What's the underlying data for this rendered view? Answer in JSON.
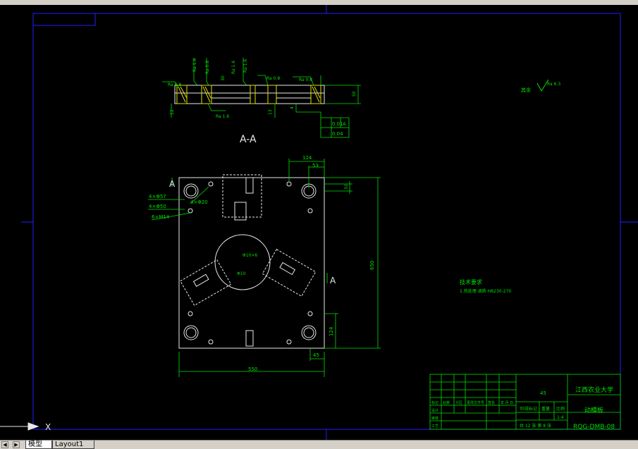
{
  "toolbar": {
    "icons": [
      "new-icon",
      "open-icon",
      "save-icon",
      "print-icon",
      "undo-icon",
      "redo-icon",
      "pan-icon",
      "zoom-icon",
      "properties-icon",
      "layer-icon",
      "color-icon",
      "linetype-icon"
    ]
  },
  "drawing": {
    "section_label": "A-A",
    "view_label_left": "A",
    "view_label_right": "A",
    "title_block": {
      "school": "江西农业大学",
      "part_name": "动模板",
      "drawing_number": "RQG-DMB-08",
      "material": "45",
      "scale": "1:4",
      "sheets": "共 12 张  第 8 张",
      "row_labels": [
        "标记",
        "处数",
        "分区",
        "更改文件号",
        "签名",
        "年 月 日"
      ],
      "designer_label": "设计",
      "checker_label": "审核",
      "process_label": "工艺",
      "stage_label": "阶段标记",
      "weight_label": "重量",
      "scale_label": "比例"
    },
    "tech_req_title": "技术要求",
    "tech_req_text": "1.热处理 调质 HB230-270",
    "roughness_rest": "其余",
    "roughness_rest_value": "Ra 6.3",
    "dims": {
      "width": "550",
      "height": "650",
      "d124_top": "124",
      "d53": "53",
      "d32": "32",
      "d45": "45",
      "d124_side": "124",
      "hole_4x57": "4×Φ57",
      "hole_4x50": "4×Φ50",
      "hole_4x20": "4×Φ20",
      "hole_6m14": "6×M14",
      "d10": "Φ10",
      "d_center": "Φ10×6",
      "thickness": "50",
      "d13": "13",
      "d12": "12",
      "ra16a": "Ra 1.6",
      "ra16b": "Ra 1.6",
      "ra16c": "Ra 1.6",
      "ra08a": "Ra 0.8",
      "ra08b": "Ra 0.8",
      "ra08c": "Ra 0.8",
      "ra16d": "Ra 1.6",
      "tol_parallel": "0.01",
      "tol_parallel_ref": "A",
      "tol_flat": "0.04",
      "d30": "30",
      "d4": "4"
    }
  },
  "tabs": {
    "model": "模型",
    "layout": "Layout1"
  },
  "ucs": {
    "x_label": "X"
  }
}
